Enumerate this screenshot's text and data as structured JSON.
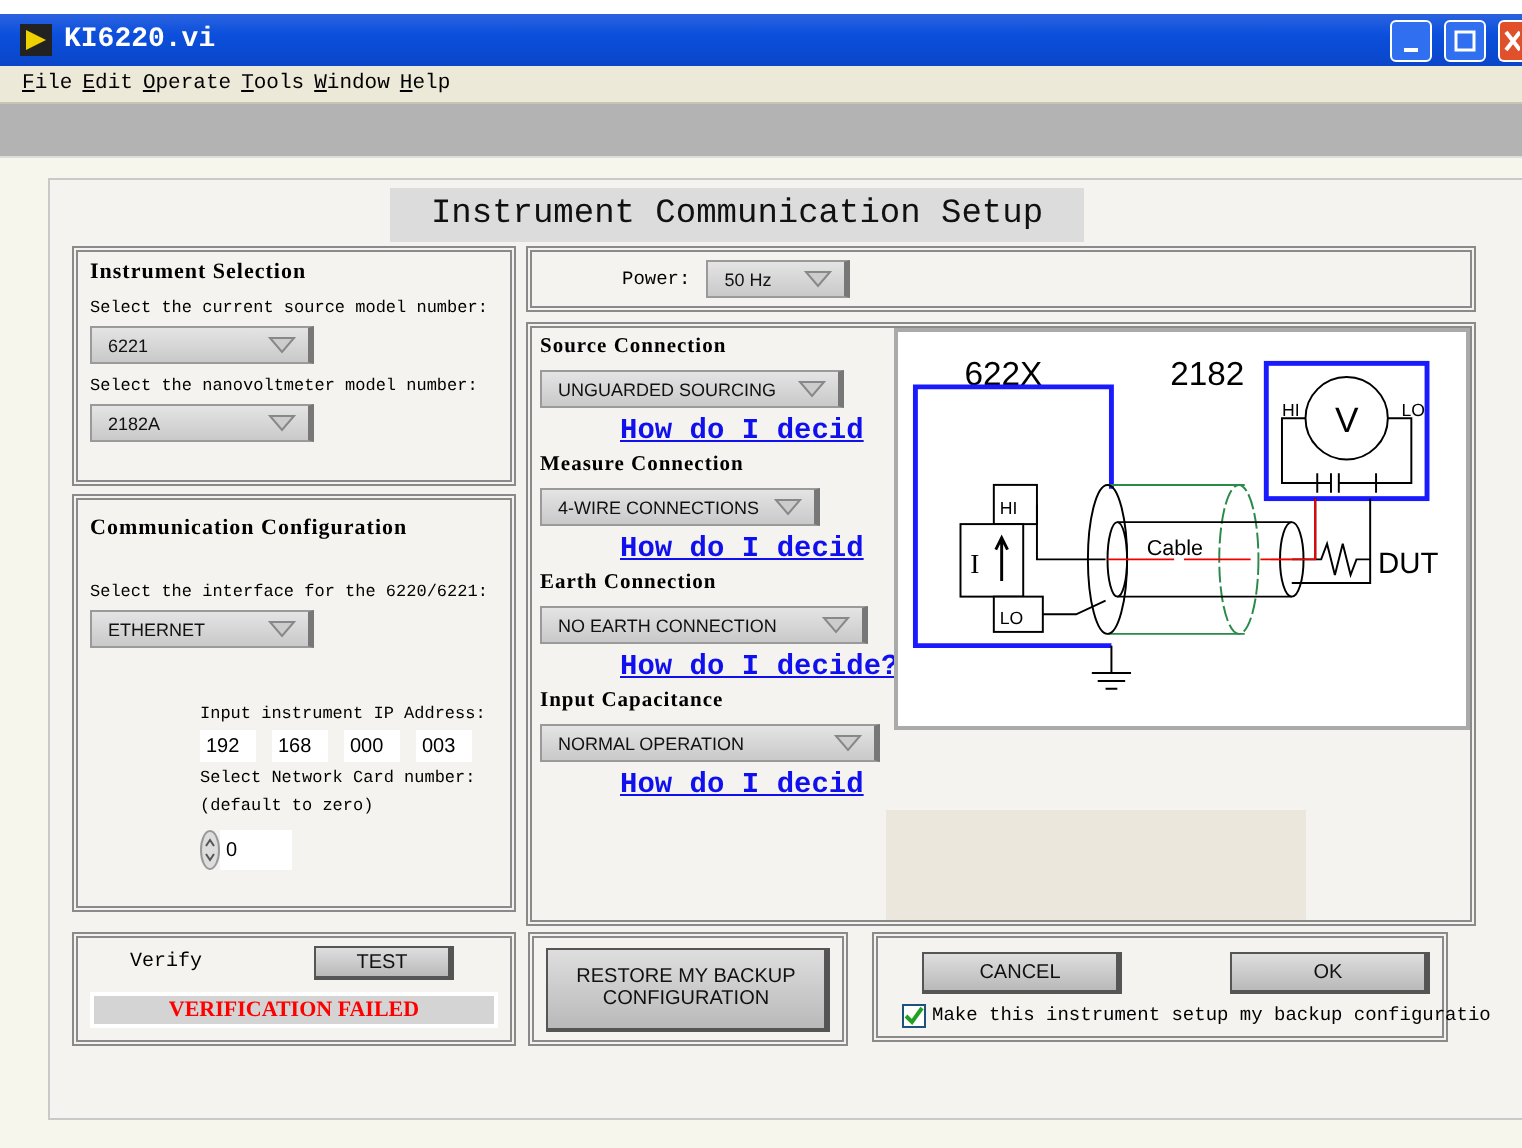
{
  "window": {
    "title": "KI6220.vi"
  },
  "menu": [
    "File",
    "Edit",
    "Operate",
    "Tools",
    "Window",
    "Help"
  ],
  "header": "Instrument Communication Setup",
  "instrument_selection": {
    "title": "Instrument Selection",
    "source_label": "Select the current source model number:",
    "source_value": "6221",
    "meter_label": "Select the nanovoltmeter model number:",
    "meter_value": "2182A"
  },
  "communication": {
    "title": "Communication Configuration",
    "interface_label": "Select the interface for the 6220/6221:",
    "interface_value": "ETHERNET",
    "ip_label": "Input instrument IP Address:",
    "ip": [
      "192",
      "168",
      "000",
      "003"
    ],
    "card_label": "Select Network Card number:",
    "card_hint": "(default to zero)",
    "card_value": "0"
  },
  "power": {
    "label": "Power:",
    "value": "50 Hz"
  },
  "connections": [
    {
      "title": "Source Connection",
      "value": "UNGUARDED SOURCING",
      "link": "How do I decid"
    },
    {
      "title": "Measure Connection",
      "value": "4-WIRE CONNECTIONS",
      "link": "How do I decid"
    },
    {
      "title": "Earth Connection",
      "value": "NO  EARTH  CONNECTION",
      "link": "How do I decide?"
    },
    {
      "title": "Input Capacitance",
      "value": "NORMAL OPERATION",
      "link": "How do I decid"
    }
  ],
  "diagram": {
    "source_name": "622X",
    "meter_name": "2182",
    "meter_symbol": "V",
    "meter_hi": "HI",
    "meter_lo": "LO",
    "source_symbol": "I",
    "source_hi": "HI",
    "source_lo": "LO",
    "cable": "Cable",
    "dut": "DUT"
  },
  "verify": {
    "label": "Verify",
    "button": "TEST",
    "status": "VERIFICATION FAILED"
  },
  "restore_button": "RESTORE MY BACKUP CONFIGURATION",
  "buttons": [
    "CANCEL",
    "OK"
  ],
  "backup_checkbox": {
    "label": "Make this instrument setup my backup configuratio",
    "checked": true
  }
}
